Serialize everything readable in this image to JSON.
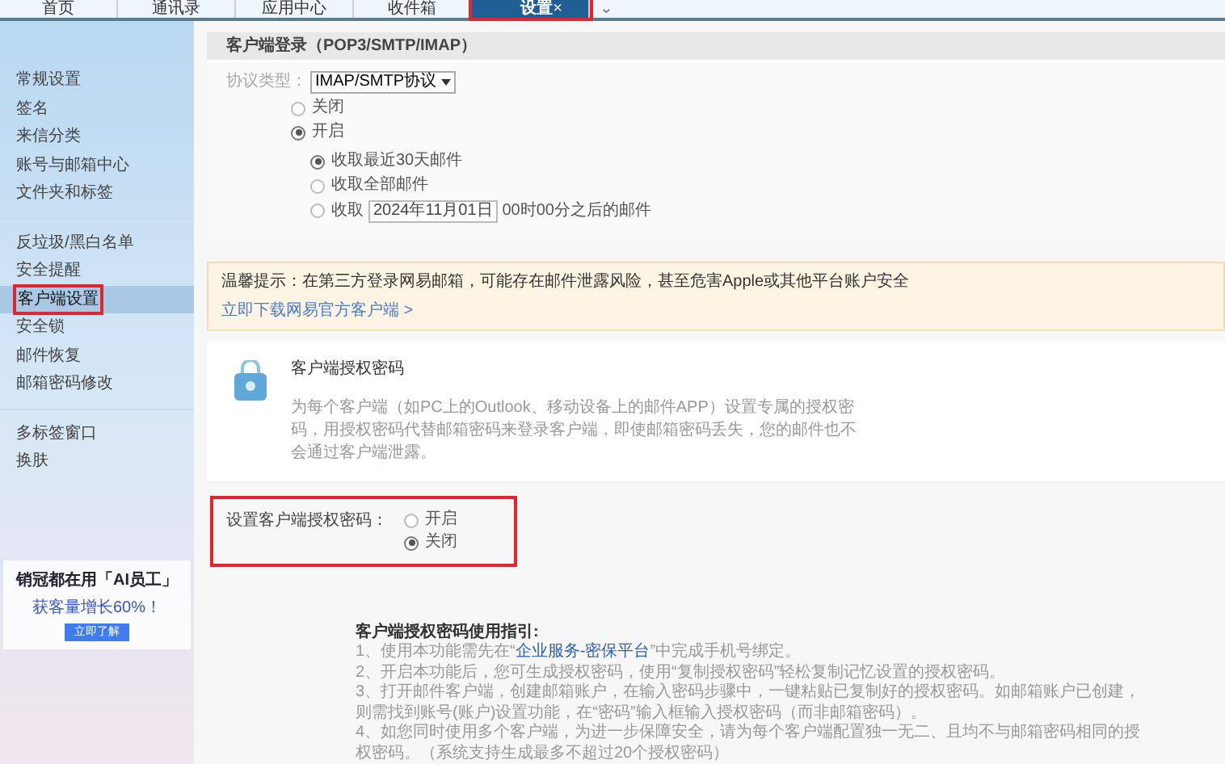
{
  "tabs": [
    {
      "label": "首页",
      "selected": false,
      "highlighted": false
    },
    {
      "label": "通讯录",
      "selected": false,
      "highlighted": false
    },
    {
      "label": "应用中心",
      "selected": false,
      "highlighted": false
    },
    {
      "label": "收件箱",
      "selected": false,
      "highlighted": false
    },
    {
      "label": "设置",
      "selected": true,
      "highlighted": true,
      "close": "×"
    }
  ],
  "tab_menu": "⌄",
  "sidebar": {
    "groups": [
      [
        {
          "label": "常规设置",
          "selected": false,
          "highlighted": false
        },
        {
          "label": "签名",
          "selected": false,
          "highlighted": false
        },
        {
          "label": "来信分类",
          "selected": false,
          "highlighted": false
        },
        {
          "label": "账号与邮箱中心",
          "selected": false,
          "highlighted": false
        },
        {
          "label": "文件夹和标签",
          "selected": false,
          "highlighted": false
        }
      ],
      [
        {
          "label": "反垃圾/黑白名单",
          "selected": false,
          "highlighted": false
        },
        {
          "label": "安全提醒",
          "selected": false,
          "highlighted": false
        },
        {
          "label": "客户端设置",
          "selected": true,
          "highlighted": true
        },
        {
          "label": "安全锁",
          "selected": false,
          "highlighted": false
        },
        {
          "label": "邮件恢复",
          "selected": false,
          "highlighted": false
        },
        {
          "label": "邮箱密码修改",
          "selected": false,
          "highlighted": false
        }
      ],
      [
        {
          "label": "多标签窗口",
          "selected": false,
          "highlighted": false
        },
        {
          "label": "换肤",
          "selected": false,
          "highlighted": false
        }
      ]
    ],
    "ad": {
      "title": "销冠都在用「AI员工」",
      "subtitle": "获客量增长60%！",
      "button": "立即了解"
    }
  },
  "login": {
    "title": "客户端登录（POP3/SMTP/IMAP）",
    "protocol_label": "协议类型：",
    "protocol_value": "IMAP/SMTP协议",
    "options": [
      {
        "label": "关闭",
        "selected": false
      },
      {
        "label": "开启",
        "selected": true
      }
    ],
    "fetch_options": [
      {
        "kind": "plain",
        "label": "收取最近30天邮件",
        "selected": true
      },
      {
        "kind": "plain",
        "label": "收取全部邮件",
        "selected": false
      },
      {
        "kind": "date",
        "label": "收取",
        "date": "2024年11月01日",
        "suffix": "00时00分之后的邮件",
        "selected": false
      }
    ]
  },
  "notice": {
    "text": "温馨提示：在第三方登录网易邮箱，可能存在邮件泄露风险，甚至危害Apple或其他平台账户安全",
    "link": "立即下载网易官方客户端 >"
  },
  "auth": {
    "title": "客户端授权密码",
    "description": "为每个客户端（如PC上的Outlook、移动设备上的邮件APP）设置专属的授权密码，用授权密码代替邮箱密码来登录客户端，即使邮箱密码丢失，您的邮件也不会通过客户端泄露。",
    "setting_label": "设置客户端授权密码：",
    "highlighted": true,
    "options": [
      {
        "label": "开启",
        "selected": false
      },
      {
        "label": "关闭",
        "selected": true
      }
    ]
  },
  "guide": {
    "title": "客户端授权密码使用指引:",
    "items": [
      {
        "before": "1、使用本功能需先在“",
        "link": "企业服务-密保平台",
        "after": "”中完成手机号绑定。"
      },
      {
        "before": "2、开启本功能后，您可生成授权密码，使用“复制授权密码”轻松复制记忆设置的授权密码。"
      },
      {
        "before": "3、打开邮件客户端，创建邮箱账户，在输入密码步骤中，一键粘贴已复制好的授权密码。如邮箱账户已创建，则需找到账号(账户)设置功能，在“密码”输入框输入授权密码（而非邮箱密码）。"
      },
      {
        "before": "4、如您同时使用多个客户端，为进一步保障安全，请为每个客户端配置独一无二、且均不与邮箱密码相同的授权密码。（系统支持生成最多不超过20个授权密码）"
      }
    ]
  }
}
